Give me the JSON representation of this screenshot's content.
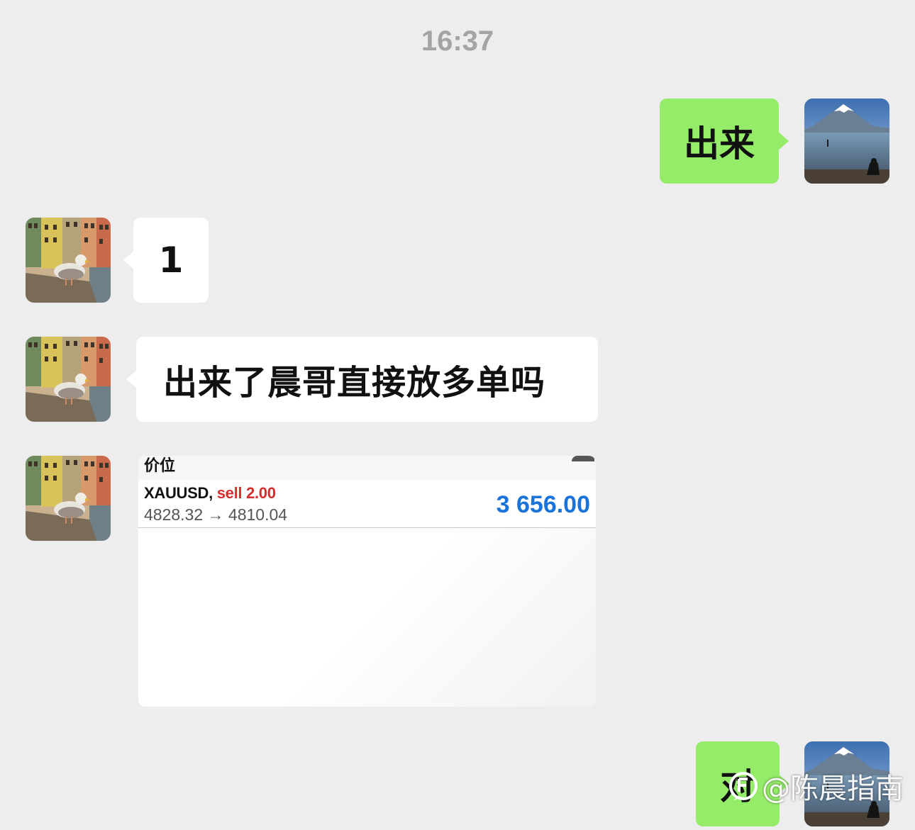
{
  "timestamp": "16:37",
  "messages": [
    {
      "side": "sent",
      "text": "出来"
    },
    {
      "side": "received",
      "text": "1"
    },
    {
      "side": "received",
      "text": "出来了晨哥直接放多单吗"
    },
    {
      "side": "sent",
      "text": "对"
    }
  ],
  "trade_card": {
    "header": "价位",
    "symbol": "XAUUSD,",
    "action": "sell 2.00",
    "prices": "4828.32 → 4810.04",
    "profit": "3 656.00"
  },
  "watermark": "@陈晨指南",
  "colors": {
    "background": "#ededed",
    "sent_bubble": "#95ec69",
    "received_bubble": "#ffffff",
    "sell_red": "#d62d2d",
    "profit_blue": "#1a73d9"
  }
}
